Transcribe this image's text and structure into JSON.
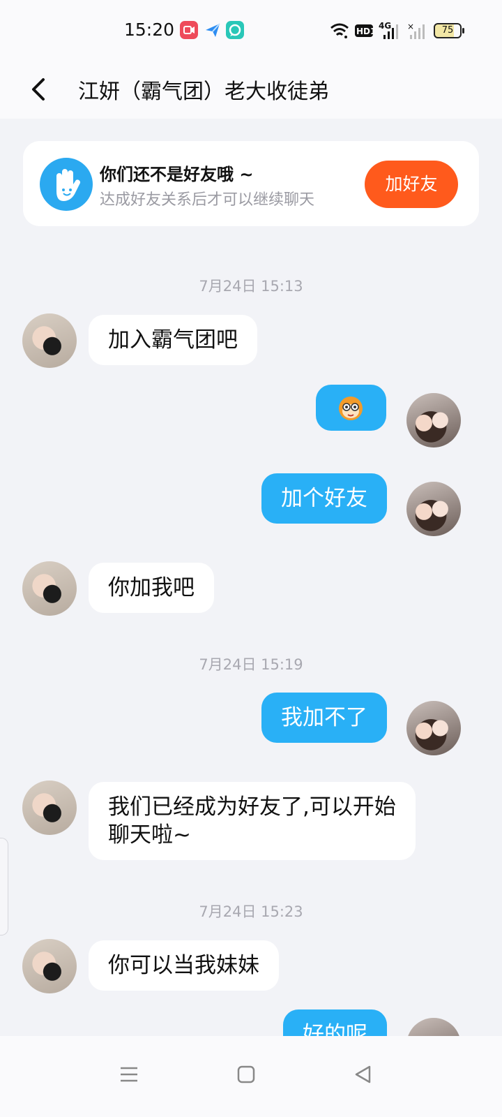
{
  "status_bar": {
    "time": "15:20",
    "battery": "75",
    "network": "4G"
  },
  "header": {
    "title": "江妍（霸气团）老大收徒弟"
  },
  "friend_notice": {
    "title": "你们还不是好友哦 ~",
    "subtitle": "达成好友关系后才可以继续聊天",
    "button": "加好友"
  },
  "messages": [
    {
      "type": "time",
      "text": "7月24日 15:13"
    },
    {
      "type": "in",
      "text": "加入霸气团吧"
    },
    {
      "type": "out",
      "sticker": "monkey-face-icon"
    },
    {
      "type": "out",
      "text": "加个好友"
    },
    {
      "type": "in",
      "text": "你加我吧"
    },
    {
      "type": "time",
      "text": "7月24日 15:19"
    },
    {
      "type": "out",
      "text": "我加不了"
    },
    {
      "type": "in",
      "line1": "我们已经成为好友了,可以开始",
      "line2": "聊天啦~"
    },
    {
      "type": "time",
      "text": "7月24日 15:23"
    },
    {
      "type": "in",
      "text": "你可以当我妹妹"
    },
    {
      "type": "out",
      "text": "好的呢"
    }
  ],
  "icons": {
    "back": "chevron-left-icon",
    "notice": "hand-wave-icon",
    "nav": [
      "menu-icon",
      "home-icon",
      "back-triangle-icon"
    ]
  },
  "colors": {
    "accent": "#29b0f6",
    "add_button": "#ff5a1c",
    "background": "#f2f3f7"
  }
}
